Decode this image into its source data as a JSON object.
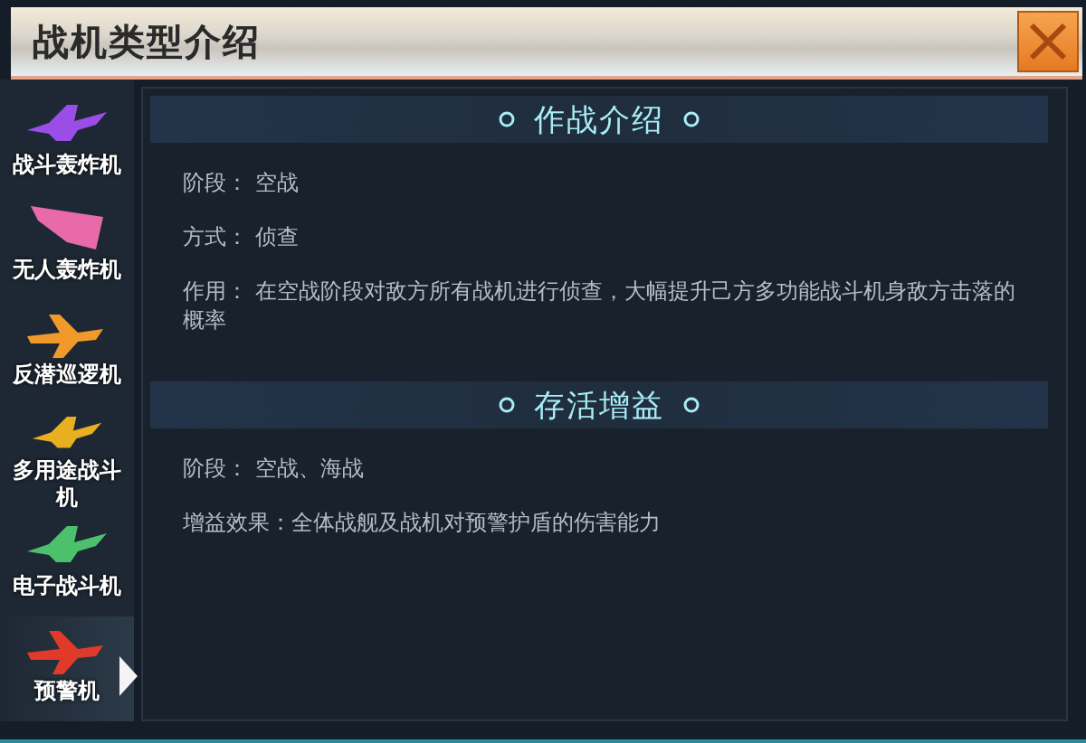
{
  "window": {
    "title": "战机类型介绍"
  },
  "sidebar": {
    "items": [
      {
        "label": "战斗轰炸机",
        "color": "#9b4de8",
        "kind": "jet",
        "selected": false
      },
      {
        "label": "无人轰炸机",
        "color": "#e86aa8",
        "kind": "wing",
        "selected": false
      },
      {
        "label": "反潜巡逻机",
        "color": "#f09a2a",
        "kind": "patrol",
        "selected": false
      },
      {
        "label": "多用途战斗机",
        "color": "#e8b020",
        "kind": "jet",
        "selected": false
      },
      {
        "label": "电子战斗机",
        "color": "#4cc06a",
        "kind": "jet",
        "selected": false
      },
      {
        "label": "预警机",
        "color": "#e03a2a",
        "kind": "patrol",
        "selected": true
      }
    ]
  },
  "sections": [
    {
      "title": "作战介绍",
      "lines": [
        "阶段：  空战",
        "方式：  侦查",
        "作用：  在空战阶段对敌方所有战机进行侦查，大幅提升己方多功能战斗机身敌方击落的概率"
      ]
    },
    {
      "title": "存活增益",
      "lines": [
        "阶段：  空战、海战",
        "增益效果：全体战舰及战机对预警护盾的伤害能力"
      ]
    }
  ]
}
